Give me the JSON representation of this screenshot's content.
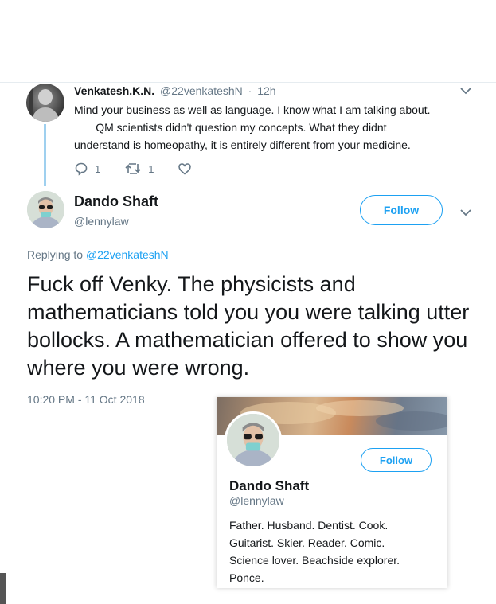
{
  "reply_tweet": {
    "name": "Venkatesh.K.N.",
    "handle": "@22venkateshN",
    "time": "12h",
    "lines": [
      "Mind your business as well as language. I know what I am talking about.",
      "       QM scientists didn't question my concepts. What they didnt",
      "understand is homeopathy, it is entirely different from your medicine."
    ],
    "reply_count": "1",
    "retweet_count": "1",
    "icons": [
      "chevron-down-icon",
      "reply-icon",
      "retweet-icon",
      "like-icon"
    ]
  },
  "main_tweet": {
    "name": "Dando Shaft",
    "handle": "@lennylaw",
    "follow_label": "Follow",
    "replying_prefix": "Replying to",
    "replying_to": "@22venkateshN",
    "text": "Fuck off Venky. The physicists and mathematicians told you you were talking utter bollocks. A mathematician offered to show you where you were wrong.",
    "timestamp": "10:20 PM - 11 Oct 2018"
  },
  "profile_card": {
    "name": "Dando Shaft",
    "handle": "@lennylaw",
    "follow_label": "Follow",
    "bio_lines": [
      "Father. Husband. Dentist. Cook.",
      "Guitarist. Skier. Reader. Comic.",
      "Science lover. Beachside explorer.",
      "Ponce."
    ]
  },
  "colors": {
    "accent": "#1da1f2",
    "secondary_text": "#657786",
    "thread_line": "#9fd0ef"
  }
}
